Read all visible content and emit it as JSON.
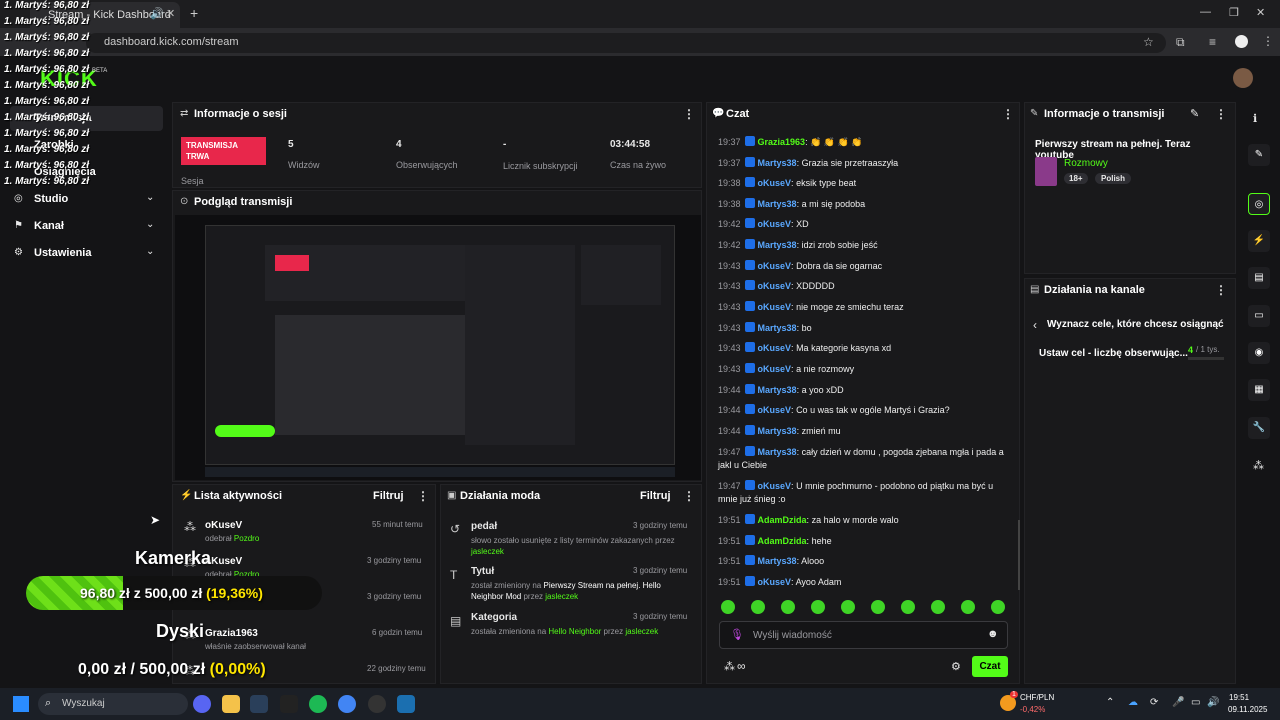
{
  "browser": {
    "tab_title": "Stream - Kick Dashboard",
    "url": "dashboard.kick.com/stream",
    "tab_prefix": "1. Martyś: 96,80 zł"
  },
  "overlay_list": [
    "1. Martyś: 96,80 zł",
    "1. Martyś: 96,80 zł",
    "1. Martyś: 96,80 zł",
    "1. Martyś: 96,80 zł",
    "1. Martyś: 96,80 zł",
    "1. Martyś: 96,80 zł",
    "1. Martyś: 96,80 zł",
    "1. Martyś: 96,80 zł",
    "1. Martyś: 96,80 zł",
    "1. Martyś: 96,80 zł",
    "1. Martyś: 96,80 zł",
    "1. Martyś: 96,80 zł"
  ],
  "logo": "KICK",
  "beta": "BETA",
  "sidebar": {
    "items": [
      {
        "label": "Transmisja"
      },
      {
        "label": "Zarobki"
      },
      {
        "label": "Osiągnięcia"
      },
      {
        "label": "Studio"
      },
      {
        "label": "Kanał"
      },
      {
        "label": "Ustawienia"
      }
    ]
  },
  "session": {
    "title": "Informacje o sesji",
    "live_badge": "TRANSMISJA TRWA",
    "session_label": "Sesja",
    "stats": [
      {
        "value": "5",
        "label": "Widzów"
      },
      {
        "value": "4",
        "label": "Obserwujących"
      },
      {
        "value": "-",
        "label": "Licznik subskrypcji"
      },
      {
        "value": "03:44:58",
        "label": "Czas na żywo"
      }
    ]
  },
  "preview": {
    "title": "Podgląd transmisji"
  },
  "activity": {
    "title": "Lista aktywności",
    "filter": "Filtruj",
    "items": [
      {
        "user": "oKuseV",
        "action": "odebrał",
        "reward": "Pozdro",
        "time": "55 minut temu"
      },
      {
        "user": "oKuseV",
        "action": "odebrał",
        "reward": "Pozdro",
        "time": "3 godziny temu"
      },
      {
        "user": "",
        "action": "",
        "reward": "",
        "time": "3 godziny temu"
      },
      {
        "user": "Grazia1963",
        "action": "właśnie zaobserwował kanał",
        "reward": "",
        "time": "6 godzin temu"
      },
      {
        "user": "",
        "action": "",
        "reward": "",
        "time": "22 godziny temu"
      }
    ]
  },
  "mod": {
    "title": "Działania moda",
    "filter": "Filtruj",
    "items": [
      {
        "name": "pedał",
        "desc": "słowo zostało usunięte z listy terminów zakazanych przez",
        "by": "jasleczek",
        "time": "3 godziny temu"
      },
      {
        "name": "Tytuł",
        "desc": "został zmieniony na",
        "value": "Pierwszy Stream na pełnej. Hello Neighbor Mod",
        "by_prefix": "przez",
        "by": "jasleczek",
        "time": "3 godziny temu"
      },
      {
        "name": "Kategoria",
        "desc": "została zmieniona na",
        "value": "Hello Neighbor",
        "by_prefix": "przez",
        "by": "jasleczek",
        "time": "3 godziny temu"
      }
    ]
  },
  "chat": {
    "title": "Czat",
    "placeholder": "Wyślij wiadomość",
    "send": "Czat",
    "messages": [
      {
        "time": "19:37",
        "user": "Grazia1963",
        "text": "👏 👏 👏 👏",
        "color": "#53fc18"
      },
      {
        "time": "19:37",
        "user": "Martys38",
        "text": "Grazia sie przetraaszyła",
        "color": "#5aa8ff"
      },
      {
        "time": "19:38",
        "user": "oKuseV",
        "text": "eksik type beat",
        "color": "#5aa8ff"
      },
      {
        "time": "19:38",
        "user": "Martys38",
        "text": "a mi się podoba",
        "color": "#5aa8ff"
      },
      {
        "time": "19:42",
        "user": "oKuseV",
        "text": "XD",
        "color": "#5aa8ff"
      },
      {
        "time": "19:42",
        "user": "Martys38",
        "text": "idzi zrob sobie jeść",
        "color": "#5aa8ff"
      },
      {
        "time": "19:43",
        "user": "oKuseV",
        "text": "Dobra da sie ogarnac",
        "color": "#5aa8ff"
      },
      {
        "time": "19:43",
        "user": "oKuseV",
        "text": "XDDDDD",
        "color": "#5aa8ff"
      },
      {
        "time": "19:43",
        "user": "oKuseV",
        "text": "nie moge ze smiechu teraz",
        "color": "#5aa8ff"
      },
      {
        "time": "19:43",
        "user": "Martys38",
        "text": "bo",
        "color": "#5aa8ff"
      },
      {
        "time": "19:43",
        "user": "oKuseV",
        "text": "Ma kategorie kasyna xd",
        "color": "#5aa8ff"
      },
      {
        "time": "19:43",
        "user": "oKuseV",
        "text": "a nie rozmowy",
        "color": "#5aa8ff"
      },
      {
        "time": "19:44",
        "user": "Martys38",
        "text": "a yoo xDD",
        "color": "#5aa8ff"
      },
      {
        "time": "19:44",
        "user": "oKuseV",
        "text": "Co u was tak w ogóle Martyś i Grazia?",
        "color": "#5aa8ff"
      },
      {
        "time": "19:44",
        "user": "Martys38",
        "text": "zmień mu",
        "color": "#5aa8ff"
      },
      {
        "time": "19:47",
        "user": "Martys38",
        "text": "cały dzień w domu , pogoda zjebana mgła i pada a jakl u Ciebie",
        "color": "#5aa8ff"
      },
      {
        "time": "19:47",
        "user": "oKuseV",
        "text": "U mnie pochmurno - podobno od piątku ma być u mnie już śnieg :o",
        "color": "#5aa8ff"
      },
      {
        "time": "19:51",
        "user": "AdamDzida",
        "text": "za halo w morde walo",
        "color": "#53fc18"
      },
      {
        "time": "19:51",
        "user": "AdamDzida",
        "text": "hehe",
        "color": "#53fc18"
      },
      {
        "time": "19:51",
        "user": "Martys38",
        "text": "Alooo",
        "color": "#5aa8ff"
      },
      {
        "time": "19:51",
        "user": "oKuseV",
        "text": "Ayoo Adam",
        "color": "#5aa8ff"
      }
    ]
  },
  "stream_info": {
    "title": "Informacje o transmisji",
    "stream_title": "Pierwszy stream na pełnej. Teraz youtube",
    "category": "Rozmowy",
    "tags": [
      "18+",
      "Polish"
    ]
  },
  "channel_actions": {
    "title": "Działania na kanale",
    "goal_header": "Wyznacz cele, które chcesz osiągnąć",
    "goal_label": "Ustaw cel - liczbę obserwując...",
    "goal_current": "4",
    "goal_total": "/ 1 tys."
  },
  "overlay": {
    "cam_label": "Kamerka",
    "cam_amount": "96,80 zł",
    "cam_sep": "z",
    "cam_goal": "500,00 zł",
    "cam_pct": "(19,36%)",
    "cam_progress": 0.1936,
    "disk_label": "Dyski",
    "disk_amount": "0,00 zł",
    "disk_sep": "/",
    "disk_goal": "500,00 zł",
    "disk_pct": "(0,00%)"
  },
  "taskbar": {
    "search": "Wyszukaj",
    "ticker": "CHF/PLN",
    "ticker_change": "-0,42%",
    "time": "19:51",
    "date": "09.11.2025",
    "notif": "1"
  }
}
